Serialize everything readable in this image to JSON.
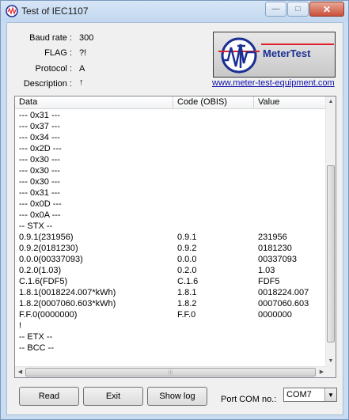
{
  "window": {
    "title": "Test of IEC1107",
    "controls": {
      "minimize": "—",
      "maximize": "□",
      "close": "✕"
    }
  },
  "info": [
    {
      "label": "Baud rate :",
      "value": "300"
    },
    {
      "label": "FLAG :",
      "value": "?!"
    },
    {
      "label": "Protocol :",
      "value": "A"
    },
    {
      "label": "Description :",
      "value": "↑"
    }
  ],
  "logo": {
    "text": "MeterTest",
    "accent_blue": "#1b2f93",
    "accent_red": "#e0202a"
  },
  "website": "www.meter-test-equipment.com",
  "table": {
    "columns": [
      "Data",
      "Code (OBIS)",
      "Value"
    ],
    "rows": [
      [
        "--- 0x31 ---",
        "",
        ""
      ],
      [
        "--- 0x37 ---",
        "",
        ""
      ],
      [
        "--- 0x34 ---",
        "",
        ""
      ],
      [
        "--- 0x2D ---",
        "",
        ""
      ],
      [
        "--- 0x30 ---",
        "",
        ""
      ],
      [
        "--- 0x30 ---",
        "",
        ""
      ],
      [
        "--- 0x30 ---",
        "",
        ""
      ],
      [
        "--- 0x31 ---",
        "",
        ""
      ],
      [
        "--- 0x0D ---",
        "",
        ""
      ],
      [
        "--- 0x0A ---",
        "",
        ""
      ],
      [
        " -- STX --",
        "",
        ""
      ],
      [
        "0.9.1(231956)",
        "0.9.1",
        "231956"
      ],
      [
        "0.9.2(0181230)",
        "0.9.2",
        "0181230"
      ],
      [
        "0.0.0(00337093)",
        "0.0.0",
        "00337093"
      ],
      [
        "0.2.0(1.03)",
        "0.2.0",
        "1.03"
      ],
      [
        "C.1.6(FDF5)",
        "C.1.6",
        "FDF5"
      ],
      [
        "1.8.1(0018224.007*kWh)",
        "1.8.1",
        "0018224.007"
      ],
      [
        "1.8.2(0007060.603*kWh)",
        "1.8.2",
        "0007060.603"
      ],
      [
        "F.F.0(0000000)",
        "F.F.0",
        "0000000"
      ],
      [
        "!",
        "",
        ""
      ],
      [
        " -- ETX --",
        "",
        ""
      ],
      [
        " -- BCC --",
        "",
        ""
      ]
    ]
  },
  "buttons": {
    "read": "Read",
    "exit": "Exit",
    "show_log": "Show log"
  },
  "port": {
    "label": "Port COM no.:",
    "selected": "COM7"
  }
}
